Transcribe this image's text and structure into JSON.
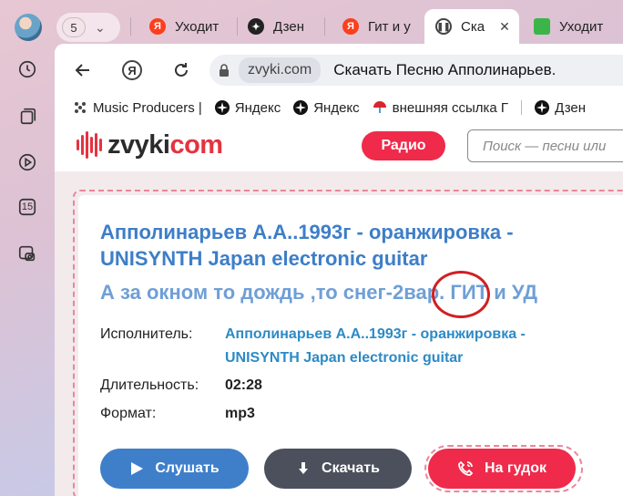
{
  "browser": {
    "tab_count": "5",
    "tabs": [
      {
        "label": "Уходит",
        "favicon": "yandex-icon",
        "color": "#fc3f1d"
      },
      {
        "label": "Дзен",
        "favicon": "zen-icon",
        "color": "#222222"
      },
      {
        "label": "Гит и у",
        "favicon": "yandex-icon",
        "color": "#fc3f1d"
      },
      {
        "label": "Ска",
        "favicon": "pause-icon",
        "color": "#444444",
        "active": true
      },
      {
        "label": "Уходит",
        "favicon": "green-square-icon",
        "color": "#3bb54a"
      }
    ],
    "sidebar_badge": "15",
    "domain": "zvyki.com",
    "page_title": "Скачать Песню Апполинарьев.",
    "bookmarks": [
      {
        "label": "Music Producers |",
        "icon": "dots-icon"
      },
      {
        "label": "Яндекс",
        "icon": "zen-icon"
      },
      {
        "label": "Яндекс",
        "icon": "zen-icon"
      },
      {
        "label": "внешняя ссылка Г",
        "icon": "umbrella-icon"
      },
      {
        "label": "Дзен",
        "icon": "zen-icon"
      }
    ]
  },
  "site": {
    "logo_main": "zvyki",
    "logo_accent": "com",
    "radio_label": "Радио",
    "search_placeholder": "Поиск — песни или",
    "accent_color": "#ef2a4b"
  },
  "song": {
    "title": "Апполинарьев А.А..1993г - оранжировка - UNISYNTH Japan electronic guitar",
    "subtitle": "А за окном то дождь ,то снег-2вар. ГИТ и УД",
    "artist_label": "Исполнитель:",
    "artist": "Апполинарьев А.А..1993г - оранжировка - UNISYNTH Japan electronic guitar",
    "duration_label": "Длительность:",
    "duration": "02:28",
    "format_label": "Формат:",
    "format": "mp3"
  },
  "actions": {
    "listen": "Слушать",
    "download": "Скачать",
    "ringtone": "На гудок"
  }
}
